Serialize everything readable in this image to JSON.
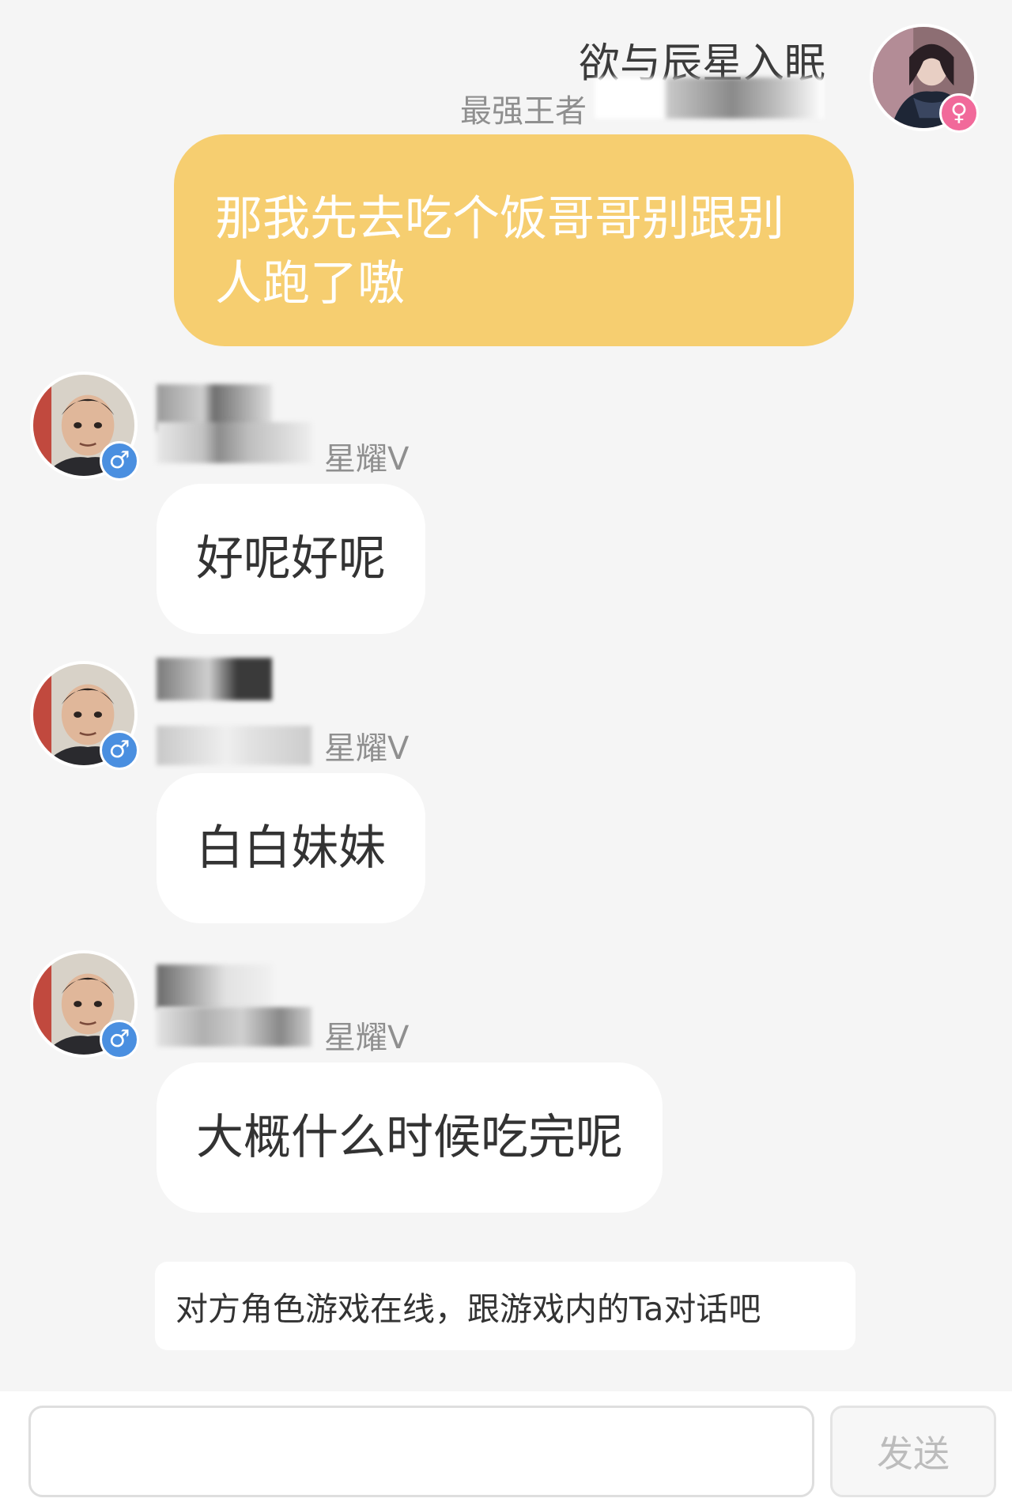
{
  "self_message": {
    "name": "欲与辰星入眠",
    "rank": "最强王者",
    "text": "那我先去吃个饭哥哥别跟别人跑了嗷",
    "gender_symbol": "♀",
    "accent_color": "#f6ce70",
    "gender_color": "#f1699a"
  },
  "other_messages": [
    {
      "tier": "星耀V",
      "text": "好呢好呢",
      "gender_symbol": "♂"
    },
    {
      "tier": "星耀V",
      "text": "白白妹妹",
      "gender_symbol": "♂"
    },
    {
      "tier": "星耀V",
      "text": "大概什么时候吃完呢",
      "gender_symbol": "♂"
    }
  ],
  "other_gender_color": "#4a8fe0",
  "notice": "对方角色游戏在线，跟游戏内的Ta对话吧",
  "input": {
    "value": "",
    "placeholder": ""
  },
  "send_button": "发送",
  "icons": [
    "avatar-icon",
    "female-icon",
    "male-icon"
  ]
}
